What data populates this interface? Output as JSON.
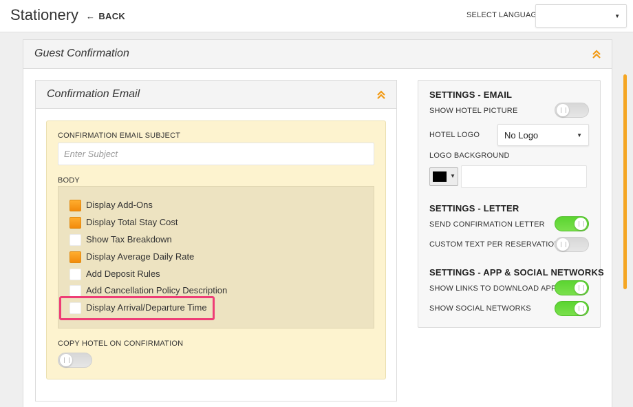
{
  "topbar": {
    "title": "Stationery",
    "back_label": "BACK",
    "language_label": "SELECT LANGUAGE",
    "language_value": ""
  },
  "guest_panel": {
    "title": "Guest Confirmation"
  },
  "email_card": {
    "title": "Confirmation Email",
    "subject_label": "CONFIRMATION EMAIL SUBJECT",
    "subject_placeholder": "Enter Subject",
    "subject_value": "",
    "body_label": "BODY",
    "options": [
      {
        "label": "Display Add-Ons",
        "checked": true
      },
      {
        "label": "Display Total Stay Cost",
        "checked": true
      },
      {
        "label": "Show Tax Breakdown",
        "checked": false
      },
      {
        "label": "Display Average Daily Rate",
        "checked": true
      },
      {
        "label": "Add Deposit Rules",
        "checked": false
      },
      {
        "label": "Add Cancellation Policy Description",
        "checked": false
      },
      {
        "label": "Display Arrival/Departure Time",
        "checked": false
      }
    ],
    "copy_hotel_label": "COPY HOTEL ON CONFIRMATION",
    "copy_hotel_on": false
  },
  "settings": {
    "email_heading": "SETTINGS - EMAIL",
    "show_hotel_picture_label": "SHOW HOTEL PICTURE",
    "show_hotel_picture_on": false,
    "hotel_logo_label": "HOTEL LOGO",
    "hotel_logo_value": "No Logo",
    "logo_background_label": "LOGO BACKGROUND",
    "logo_background_color": "#000000",
    "logo_background_value": "",
    "letter_heading": "SETTINGS - LETTER",
    "send_letter_label": "SEND CONFIRMATION LETTER",
    "send_letter_on": true,
    "custom_text_label": "CUSTOM TEXT PER RESERVATION",
    "custom_text_on": false,
    "app_heading": "SETTINGS - APP & SOCIAL NETWORKS",
    "show_links_label": "SHOW LINKS TO DOWNLOAD APP",
    "show_links_on": true,
    "show_social_label": "SHOW SOCIAL NETWORKS",
    "show_social_on": true
  },
  "colors": {
    "accent": "#f29a14",
    "toggle_on": "#5bd431",
    "highlight": "#ee3d76",
    "email_body_bg": "#fdf3cf"
  }
}
